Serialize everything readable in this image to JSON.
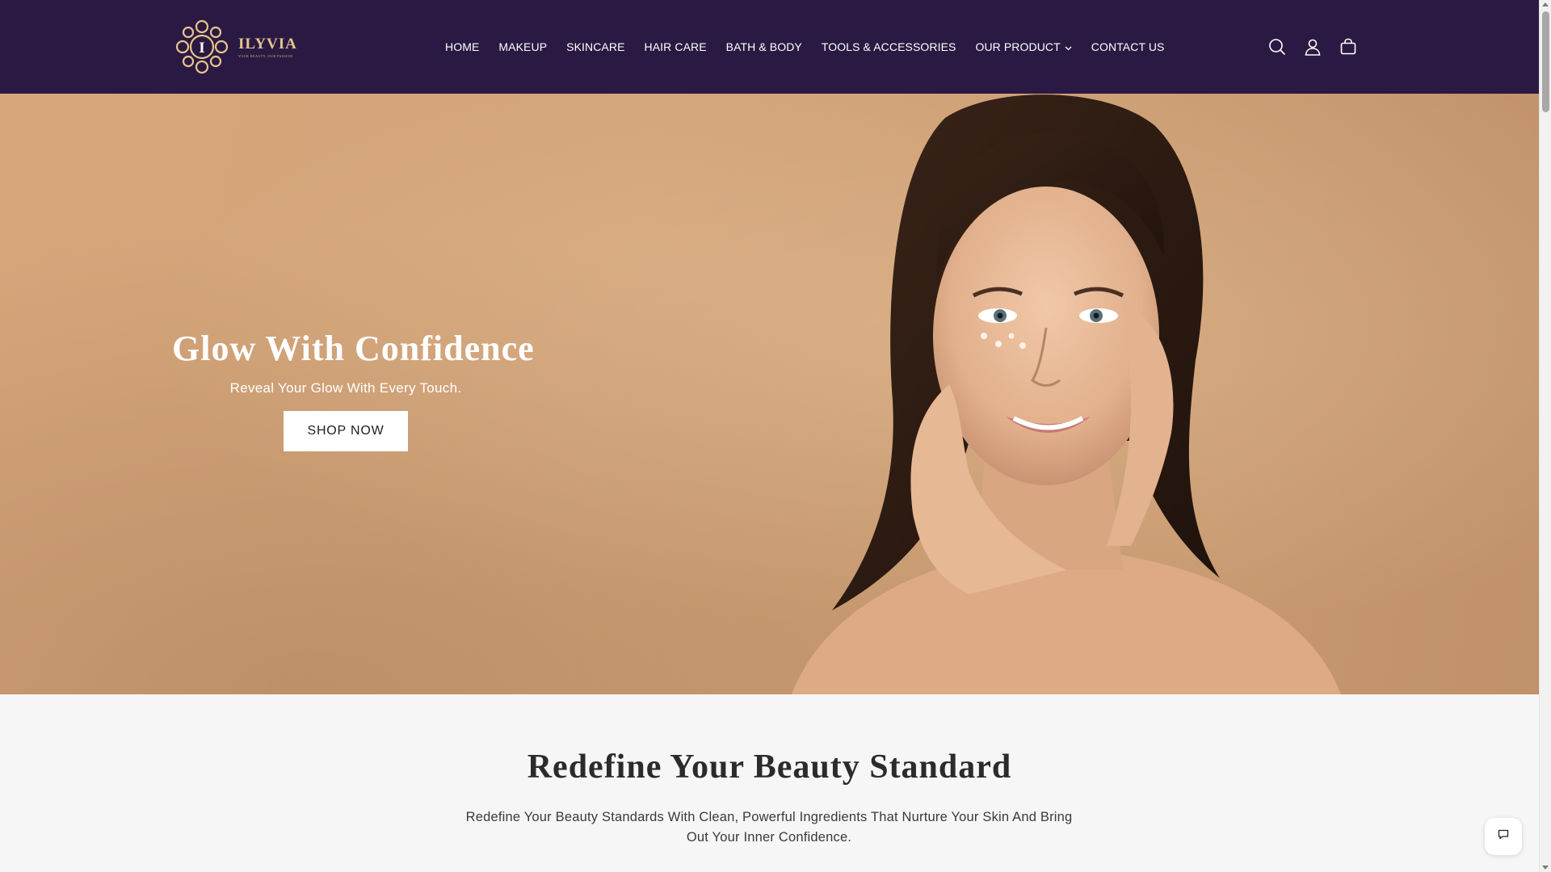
{
  "brand": {
    "name": "ILYVIA",
    "tagline": "YOUR BEAUTY, OUR PASSION",
    "monogram": "I",
    "colors": {
      "header_bg": "#2a1a43",
      "logo_gold": "#e7c48c",
      "hero_bg": "#d3a479"
    }
  },
  "nav": {
    "items": [
      {
        "label": "HOME"
      },
      {
        "label": "MAKEUP"
      },
      {
        "label": "SKINCARE"
      },
      {
        "label": "HAIR CARE"
      },
      {
        "label": "BATH & BODY"
      },
      {
        "label": "TOOLS & ACCESSORIES"
      },
      {
        "label": "OUR PRODUCT",
        "has_dropdown": true
      },
      {
        "label": "CONTACT US"
      }
    ]
  },
  "header_icons": [
    "search-icon",
    "account-icon",
    "cart-icon"
  ],
  "hero": {
    "title": "Glow With Confidence",
    "subtitle": "Reveal Your Glow With Every Touch.",
    "cta_label": "SHOP NOW"
  },
  "section": {
    "title": "Redefine Your Beauty Standard",
    "description": "Redefine Your Beauty Standards With Clean, Powerful Ingredients That Nurture Your Skin And Bring Out Your Inner Confidence."
  },
  "chat": {
    "icon": "chat-icon"
  }
}
